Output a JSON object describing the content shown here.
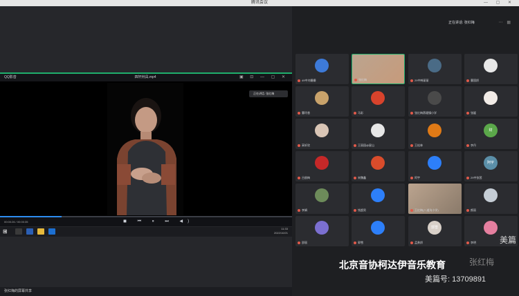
{
  "window": {
    "title": "腾讯会议",
    "controls": "—  ▢  ✕"
  },
  "player": {
    "source": "QQ影音",
    "filename": "四轩卅具.mp4",
    "controls": "▣ ⊡ — ▢ ✕",
    "speaker_badge": "正在讲话: 张红梅",
    "time": "00:00:26 / 00:00:35",
    "progress": 0.21,
    "buttons": "◼ ⏮ ⏸ ⏭ ◀)"
  },
  "taskbar": {
    "time": "11:33",
    "date": "2022/10/21"
  },
  "share": {
    "label": "张红梅的屏幕共享"
  },
  "right_panel": {
    "speaking": "正在讲话: 张红梅",
    "participants": [
      {
        "name": "49中刘姗姗",
        "color": "#3d7ad8"
      },
      {
        "name": "张红梅",
        "color": "#c79a7a"
      },
      {
        "name": "29中韩丽丽",
        "color": "#4a6b86"
      },
      {
        "name": "曹国娇",
        "color": "#e8e8e8"
      },
      {
        "name": "曹玲香",
        "color": "#c9a36b"
      },
      {
        "name": "马彩",
        "color": "#d8432c"
      },
      {
        "name": "张红梅燕塘镇小学",
        "color": "#4a4a4a"
      },
      {
        "name": "张媛",
        "color": "#f2ece7"
      },
      {
        "name": "高轩欣",
        "color": "#d9c5b5"
      },
      {
        "name": "王丽园@星山",
        "color": "#e7e7e7"
      },
      {
        "name": "王松林",
        "color": "#e07a16"
      },
      {
        "name": "李丹",
        "color": "#5ba84a"
      },
      {
        "name": "吕俊梅",
        "color": "#c62828"
      },
      {
        "name": "宋魏鑫",
        "color": "#d94c2b"
      },
      {
        "name": "阿宇",
        "color": "#2d7ff9"
      },
      {
        "name": "29中张茜",
        "color": "#5b8fa8"
      },
      {
        "name": "李娟",
        "color": "#6d8b5a"
      },
      {
        "name": "钱超男",
        "color": "#2d7ff9"
      },
      {
        "name": "王红梅(八道沟小学)",
        "color": "#8a7a6a"
      },
      {
        "name": "颜丽",
        "color": "#c5cdd5"
      },
      {
        "name": "邵丽",
        "color": "#7b6fd0"
      },
      {
        "name": "郭雪",
        "color": "#2d7ff9"
      },
      {
        "name": "孟勇娇",
        "color": "#d8d0c8"
      },
      {
        "name": "李明",
        "color": "#e57f9f"
      }
    ]
  },
  "avatar_texts": {
    "a15": "阿宇",
    "a18": "超男",
    "a22": "郭雪",
    "a11": "财"
  },
  "watermark": {
    "meipian": "美篇",
    "title": "北京音协柯达伊音乐教育",
    "id": "美篇号: 13709891",
    "ghost": "张红梅"
  }
}
